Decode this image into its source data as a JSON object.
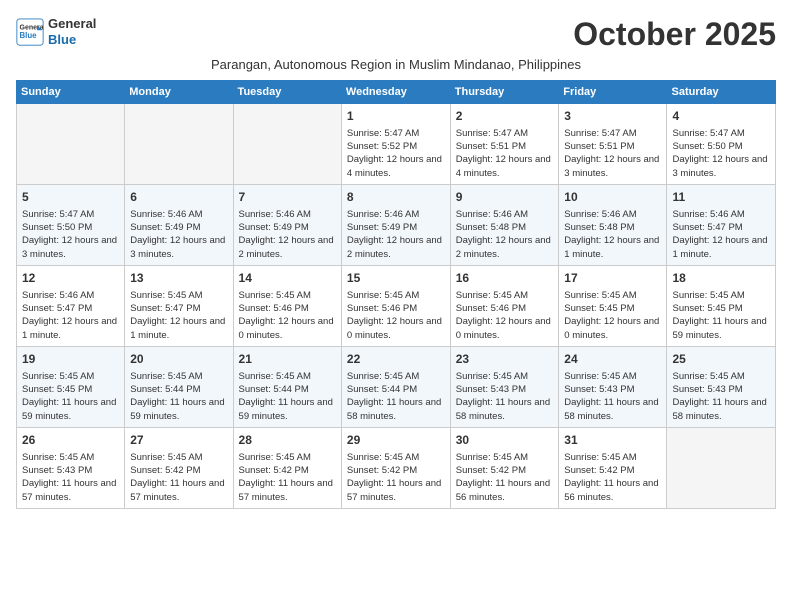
{
  "header": {
    "logo_line1": "General",
    "logo_line2": "Blue",
    "month": "October 2025",
    "subtitle": "Parangan, Autonomous Region in Muslim Mindanao, Philippines"
  },
  "days_of_week": [
    "Sunday",
    "Monday",
    "Tuesday",
    "Wednesday",
    "Thursday",
    "Friday",
    "Saturday"
  ],
  "weeks": [
    [
      {
        "day": "",
        "data": ""
      },
      {
        "day": "",
        "data": ""
      },
      {
        "day": "",
        "data": ""
      },
      {
        "day": "1",
        "data": "Sunrise: 5:47 AM\nSunset: 5:52 PM\nDaylight: 12 hours and 4 minutes."
      },
      {
        "day": "2",
        "data": "Sunrise: 5:47 AM\nSunset: 5:51 PM\nDaylight: 12 hours and 4 minutes."
      },
      {
        "day": "3",
        "data": "Sunrise: 5:47 AM\nSunset: 5:51 PM\nDaylight: 12 hours and 3 minutes."
      },
      {
        "day": "4",
        "data": "Sunrise: 5:47 AM\nSunset: 5:50 PM\nDaylight: 12 hours and 3 minutes."
      }
    ],
    [
      {
        "day": "5",
        "data": "Sunrise: 5:47 AM\nSunset: 5:50 PM\nDaylight: 12 hours and 3 minutes."
      },
      {
        "day": "6",
        "data": "Sunrise: 5:46 AM\nSunset: 5:49 PM\nDaylight: 12 hours and 3 minutes."
      },
      {
        "day": "7",
        "data": "Sunrise: 5:46 AM\nSunset: 5:49 PM\nDaylight: 12 hours and 2 minutes."
      },
      {
        "day": "8",
        "data": "Sunrise: 5:46 AM\nSunset: 5:49 PM\nDaylight: 12 hours and 2 minutes."
      },
      {
        "day": "9",
        "data": "Sunrise: 5:46 AM\nSunset: 5:48 PM\nDaylight: 12 hours and 2 minutes."
      },
      {
        "day": "10",
        "data": "Sunrise: 5:46 AM\nSunset: 5:48 PM\nDaylight: 12 hours and 1 minute."
      },
      {
        "day": "11",
        "data": "Sunrise: 5:46 AM\nSunset: 5:47 PM\nDaylight: 12 hours and 1 minute."
      }
    ],
    [
      {
        "day": "12",
        "data": "Sunrise: 5:46 AM\nSunset: 5:47 PM\nDaylight: 12 hours and 1 minute."
      },
      {
        "day": "13",
        "data": "Sunrise: 5:45 AM\nSunset: 5:47 PM\nDaylight: 12 hours and 1 minute."
      },
      {
        "day": "14",
        "data": "Sunrise: 5:45 AM\nSunset: 5:46 PM\nDaylight: 12 hours and 0 minutes."
      },
      {
        "day": "15",
        "data": "Sunrise: 5:45 AM\nSunset: 5:46 PM\nDaylight: 12 hours and 0 minutes."
      },
      {
        "day": "16",
        "data": "Sunrise: 5:45 AM\nSunset: 5:46 PM\nDaylight: 12 hours and 0 minutes."
      },
      {
        "day": "17",
        "data": "Sunrise: 5:45 AM\nSunset: 5:45 PM\nDaylight: 12 hours and 0 minutes."
      },
      {
        "day": "18",
        "data": "Sunrise: 5:45 AM\nSunset: 5:45 PM\nDaylight: 11 hours and 59 minutes."
      }
    ],
    [
      {
        "day": "19",
        "data": "Sunrise: 5:45 AM\nSunset: 5:45 PM\nDaylight: 11 hours and 59 minutes."
      },
      {
        "day": "20",
        "data": "Sunrise: 5:45 AM\nSunset: 5:44 PM\nDaylight: 11 hours and 59 minutes."
      },
      {
        "day": "21",
        "data": "Sunrise: 5:45 AM\nSunset: 5:44 PM\nDaylight: 11 hours and 59 minutes."
      },
      {
        "day": "22",
        "data": "Sunrise: 5:45 AM\nSunset: 5:44 PM\nDaylight: 11 hours and 58 minutes."
      },
      {
        "day": "23",
        "data": "Sunrise: 5:45 AM\nSunset: 5:43 PM\nDaylight: 11 hours and 58 minutes."
      },
      {
        "day": "24",
        "data": "Sunrise: 5:45 AM\nSunset: 5:43 PM\nDaylight: 11 hours and 58 minutes."
      },
      {
        "day": "25",
        "data": "Sunrise: 5:45 AM\nSunset: 5:43 PM\nDaylight: 11 hours and 58 minutes."
      }
    ],
    [
      {
        "day": "26",
        "data": "Sunrise: 5:45 AM\nSunset: 5:43 PM\nDaylight: 11 hours and 57 minutes."
      },
      {
        "day": "27",
        "data": "Sunrise: 5:45 AM\nSunset: 5:42 PM\nDaylight: 11 hours and 57 minutes."
      },
      {
        "day": "28",
        "data": "Sunrise: 5:45 AM\nSunset: 5:42 PM\nDaylight: 11 hours and 57 minutes."
      },
      {
        "day": "29",
        "data": "Sunrise: 5:45 AM\nSunset: 5:42 PM\nDaylight: 11 hours and 57 minutes."
      },
      {
        "day": "30",
        "data": "Sunrise: 5:45 AM\nSunset: 5:42 PM\nDaylight: 11 hours and 56 minutes."
      },
      {
        "day": "31",
        "data": "Sunrise: 5:45 AM\nSunset: 5:42 PM\nDaylight: 11 hours and 56 minutes."
      },
      {
        "day": "",
        "data": ""
      }
    ]
  ]
}
